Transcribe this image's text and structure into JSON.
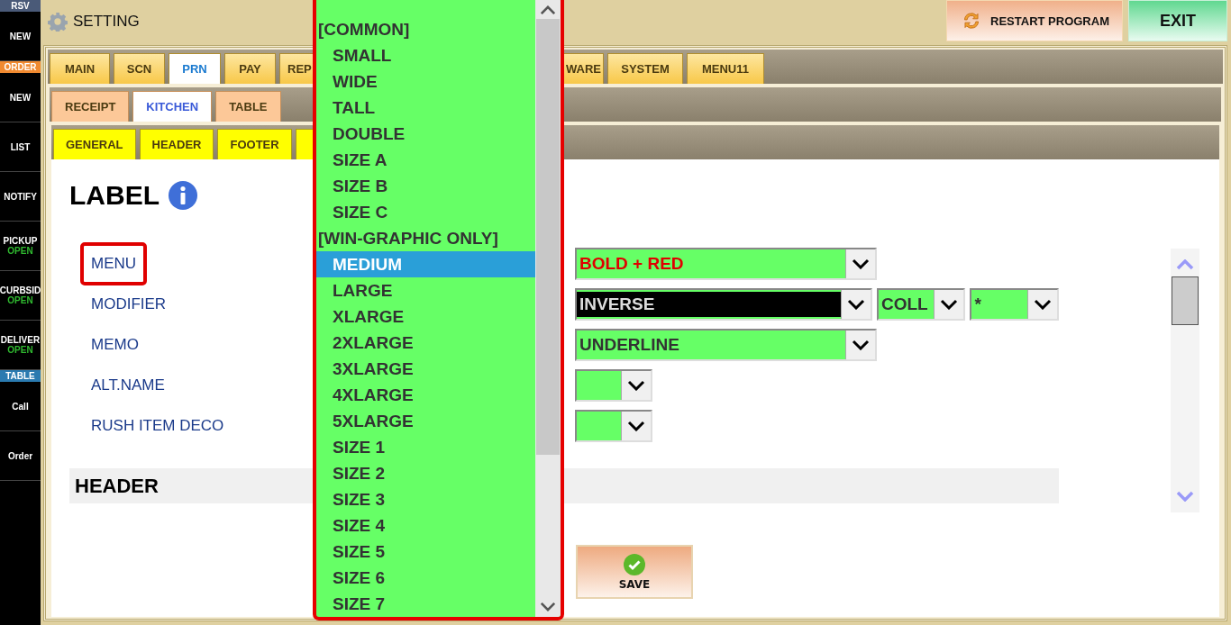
{
  "sidebar": {
    "items": [
      {
        "kind": "header",
        "label": "RSV",
        "color": "#4a5a78"
      },
      {
        "kind": "button",
        "label": "NEW"
      },
      {
        "kind": "header",
        "label": "ORDER",
        "color": "#f08a30"
      },
      {
        "kind": "button",
        "label": "NEW"
      },
      {
        "kind": "button",
        "label": "LIST"
      },
      {
        "kind": "button",
        "label": "NOTIFY"
      },
      {
        "kind": "button",
        "label": "PICKUP",
        "status": "OPEN"
      },
      {
        "kind": "button",
        "label": "CURBSID",
        "status": "OPEN"
      },
      {
        "kind": "button",
        "label": "DELIVER",
        "status": "OPEN"
      },
      {
        "kind": "header",
        "label": "TABLE",
        "color": "#2a7ab0"
      },
      {
        "kind": "button",
        "label": "Call"
      },
      {
        "kind": "button",
        "label": "Order"
      }
    ]
  },
  "header": {
    "title": "SETTING",
    "buttons": [
      {
        "kind": "restart",
        "label": "RESTART PROGRAM"
      },
      {
        "kind": "exit",
        "label": "EXIT"
      }
    ]
  },
  "main_tabs": [
    {
      "label": "MAIN",
      "selected": false
    },
    {
      "label": "SCN",
      "selected": false
    },
    {
      "label": "PRN",
      "selected": true
    },
    {
      "label": "PAY",
      "selected": false
    },
    {
      "label": "REP",
      "selected": false
    },
    {
      "label": "WARE",
      "selected": false
    },
    {
      "label": "SYSTEM",
      "selected": false
    },
    {
      "label": "MENU11",
      "selected": false
    }
  ],
  "sub_tabs": [
    {
      "label": "RECEIPT",
      "selected": false
    },
    {
      "label": "KITCHEN",
      "selected": true
    },
    {
      "label": "TABLE",
      "selected": false
    }
  ],
  "section_tabs": [
    {
      "label": "GENERAL",
      "selected": false
    },
    {
      "label": "HEADER",
      "selected": false
    },
    {
      "label": "FOOTER",
      "selected": false
    },
    {
      "selected": false
    }
  ],
  "content": {
    "title": "LABEL",
    "rows": [
      {
        "label": "MENU",
        "selected": true,
        "selects": [
          {
            "value": "BOLD + RED",
            "kind": "red"
          }
        ]
      },
      {
        "label": "MODIFIER",
        "selected": false,
        "selects": [
          {
            "value": "INVERSE",
            "kind": "inverse"
          },
          {
            "value": "COLL",
            "kind": "plain"
          },
          {
            "value": "*",
            "kind": "plain"
          }
        ]
      },
      {
        "label": "MEMO",
        "selected": false,
        "selects": [
          {
            "value": "UNDERLINE",
            "kind": "plain"
          }
        ]
      },
      {
        "label": "ALT.NAME",
        "selected": false,
        "selects": [
          {
            "kind": "plain"
          }
        ]
      },
      {
        "label": "RUSH ITEM DECO",
        "selected": false,
        "selects": [
          {
            "kind": "plain"
          }
        ]
      }
    ],
    "section_header": "HEADER",
    "save_button": "SAVE"
  },
  "dropdown_list": {
    "items": [
      {
        "kind": "group",
        "label": "[COMMON]"
      },
      {
        "kind": "option",
        "label": "SMALL",
        "selected": false
      },
      {
        "kind": "option",
        "label": "WIDE",
        "selected": false
      },
      {
        "kind": "option",
        "label": "TALL",
        "selected": false
      },
      {
        "kind": "option",
        "label": "DOUBLE",
        "selected": false
      },
      {
        "kind": "option",
        "label": "SIZE A",
        "selected": false
      },
      {
        "kind": "option",
        "label": "SIZE B",
        "selected": false
      },
      {
        "kind": "option",
        "label": "SIZE C",
        "selected": false
      },
      {
        "kind": "group",
        "label": "[WIN-GRAPHIC ONLY]"
      },
      {
        "kind": "option",
        "label": "MEDIUM",
        "selected": true
      },
      {
        "kind": "option",
        "label": "LARGE",
        "selected": false
      },
      {
        "kind": "option",
        "label": "XLARGE",
        "selected": false
      },
      {
        "kind": "option",
        "label": "2XLARGE",
        "selected": false
      },
      {
        "kind": "option",
        "label": "3XLARGE",
        "selected": false
      },
      {
        "kind": "option",
        "label": "4XLARGE",
        "selected": false
      },
      {
        "kind": "option",
        "label": "5XLARGE",
        "selected": false
      },
      {
        "kind": "option",
        "label": "SIZE 1",
        "selected": false
      },
      {
        "kind": "option",
        "label": "SIZE 2",
        "selected": false
      },
      {
        "kind": "option",
        "label": "SIZE 3",
        "selected": false
      },
      {
        "kind": "option",
        "label": "SIZE 4",
        "selected": false
      },
      {
        "kind": "option",
        "label": "SIZE 5",
        "selected": false
      },
      {
        "kind": "option",
        "label": "SIZE 6",
        "selected": false
      },
      {
        "kind": "option",
        "label": "SIZE 7",
        "selected": false
      }
    ]
  }
}
